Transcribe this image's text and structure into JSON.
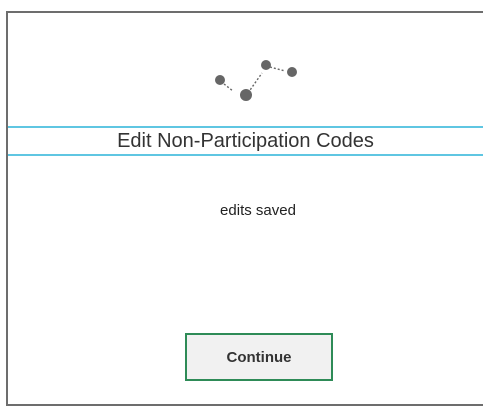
{
  "dialog": {
    "title": "Edit Non-Participation Codes",
    "message": "edits saved",
    "continue_label": "Continue"
  },
  "icons": {
    "logo": "connected-dots-icon"
  },
  "colors": {
    "accent_line": "#5fc6e2",
    "button_border": "#2e8b57",
    "button_bg": "#f1f1f1",
    "frame_border": "#6d6d6d",
    "logo_dots": "#666666"
  }
}
